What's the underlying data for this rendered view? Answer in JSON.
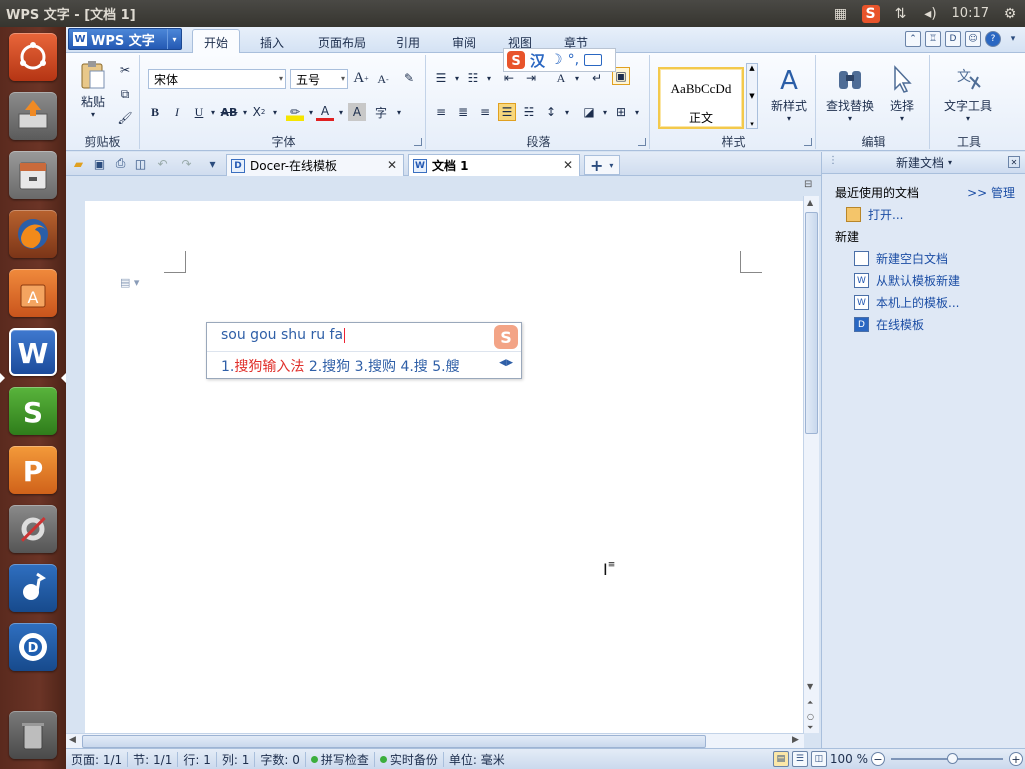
{
  "window": {
    "title": "WPS 文字 - [文档 1]"
  },
  "system_tray": {
    "time": "10:17"
  },
  "launcher": [
    "ubuntu-home",
    "software-updater",
    "file-manager",
    "firefox",
    "ubuntu-software-center",
    "wps-writer",
    "wps-spreadsheets",
    "wps-presentation",
    "system-settings",
    "music-player",
    "deepin-player",
    "trash"
  ],
  "app_menu": {
    "wps_button": "WPS 文字",
    "tabs": [
      "开始",
      "插入",
      "页面布局",
      "引用",
      "审阅",
      "视图",
      "章节"
    ],
    "active_tab": "开始"
  },
  "ribbon": {
    "clipboard": {
      "label": "剪贴板",
      "paste": "粘贴"
    },
    "font": {
      "label": "字体",
      "font_name": "宋体",
      "font_size": "五号"
    },
    "paragraph": {
      "label": "段落"
    },
    "styles": {
      "label": "样式",
      "sample": "AaBbCcDd",
      "style_name": "正文",
      "new_style": "新样式"
    },
    "edit": {
      "label": "编辑",
      "find_replace": "查找替换",
      "select": "选择"
    },
    "tools": {
      "label": "工具",
      "text_tools": "文字工具"
    }
  },
  "doc_tabs": [
    {
      "label": "Docer-在线模板",
      "active": false
    },
    {
      "label": "文档 1",
      "active": true
    }
  ],
  "ime": {
    "input": "sou gou shu ru fa",
    "candidates": [
      {
        "num": "1.",
        "text": "搜狗输入法"
      },
      {
        "num": "2.",
        "text": "搜狗"
      },
      {
        "num": "3.",
        "text": "搜购"
      },
      {
        "num": "4.",
        "text": "搜"
      },
      {
        "num": "5.",
        "text": "艘"
      }
    ],
    "status_char": "汉"
  },
  "task_pane": {
    "title": "新建文档",
    "recent_label": "最近使用的文档",
    "manage": ">> 管理",
    "open": "打开...",
    "new_label": "新建",
    "links": [
      "新建空白文档",
      "从默认模板新建",
      "本机上的模板...",
      "在线模板"
    ]
  },
  "status_bar": {
    "page": "页面: 1/1",
    "section": "节: 1/1",
    "row": "行: 1",
    "col": "列: 1",
    "words": "字数: 0",
    "spell": "拼写检查",
    "backup": "实时备份",
    "unit": "单位: 毫米",
    "zoom": "100 %"
  }
}
